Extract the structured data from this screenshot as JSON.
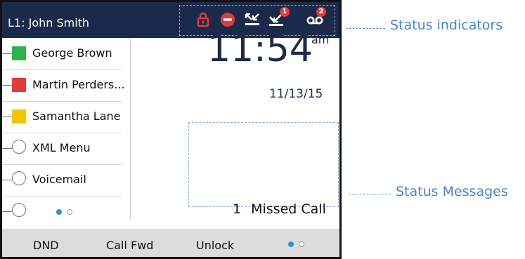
{
  "header": {
    "line_label": "L1: John Smith"
  },
  "status_icons": [
    {
      "icon": "lock-icon",
      "color": "#e33a3a"
    },
    {
      "icon": "dnd-icon",
      "color": "#e33a3a"
    },
    {
      "icon": "call-forward-icon",
      "color": "#ffffff"
    },
    {
      "icon": "missed-calls-icon",
      "color": "#ffffff",
      "badge": "1"
    },
    {
      "icon": "voicemail-icon",
      "color": "#ffffff",
      "badge": "2"
    }
  ],
  "sidebar": {
    "items": [
      {
        "label": "George Brown",
        "status": "green"
      },
      {
        "label": "Martin Perders...",
        "status": "red"
      },
      {
        "label": "Samantha Lane",
        "status": "yellow"
      },
      {
        "label": "XML Menu",
        "status": "none"
      },
      {
        "label": "Voicemail",
        "status": "none"
      },
      {
        "label": "",
        "status": "none"
      }
    ],
    "page_dots": {
      "current": 1,
      "total": 2
    }
  },
  "clock": {
    "time": "11:54",
    "ampm": "am",
    "date": "11/13/15"
  },
  "status_message": {
    "count": "1",
    "text": "Missed Call"
  },
  "softkeys": {
    "labels": [
      "DND",
      "Call Fwd",
      "Unlock"
    ],
    "page_dots": {
      "current": 1,
      "total": 2
    }
  },
  "callouts": {
    "status_indicators": "Status indicators",
    "status_messages": "Status Messages"
  },
  "colors": {
    "topbar": "#1b2a4a",
    "status_red": "#e33a3a",
    "presence_green": "#2eb34a",
    "presence_red": "#e33a3a",
    "presence_yellow": "#f5c400",
    "dot_active": "#2f8fe0",
    "callout": "#4a84c4"
  }
}
